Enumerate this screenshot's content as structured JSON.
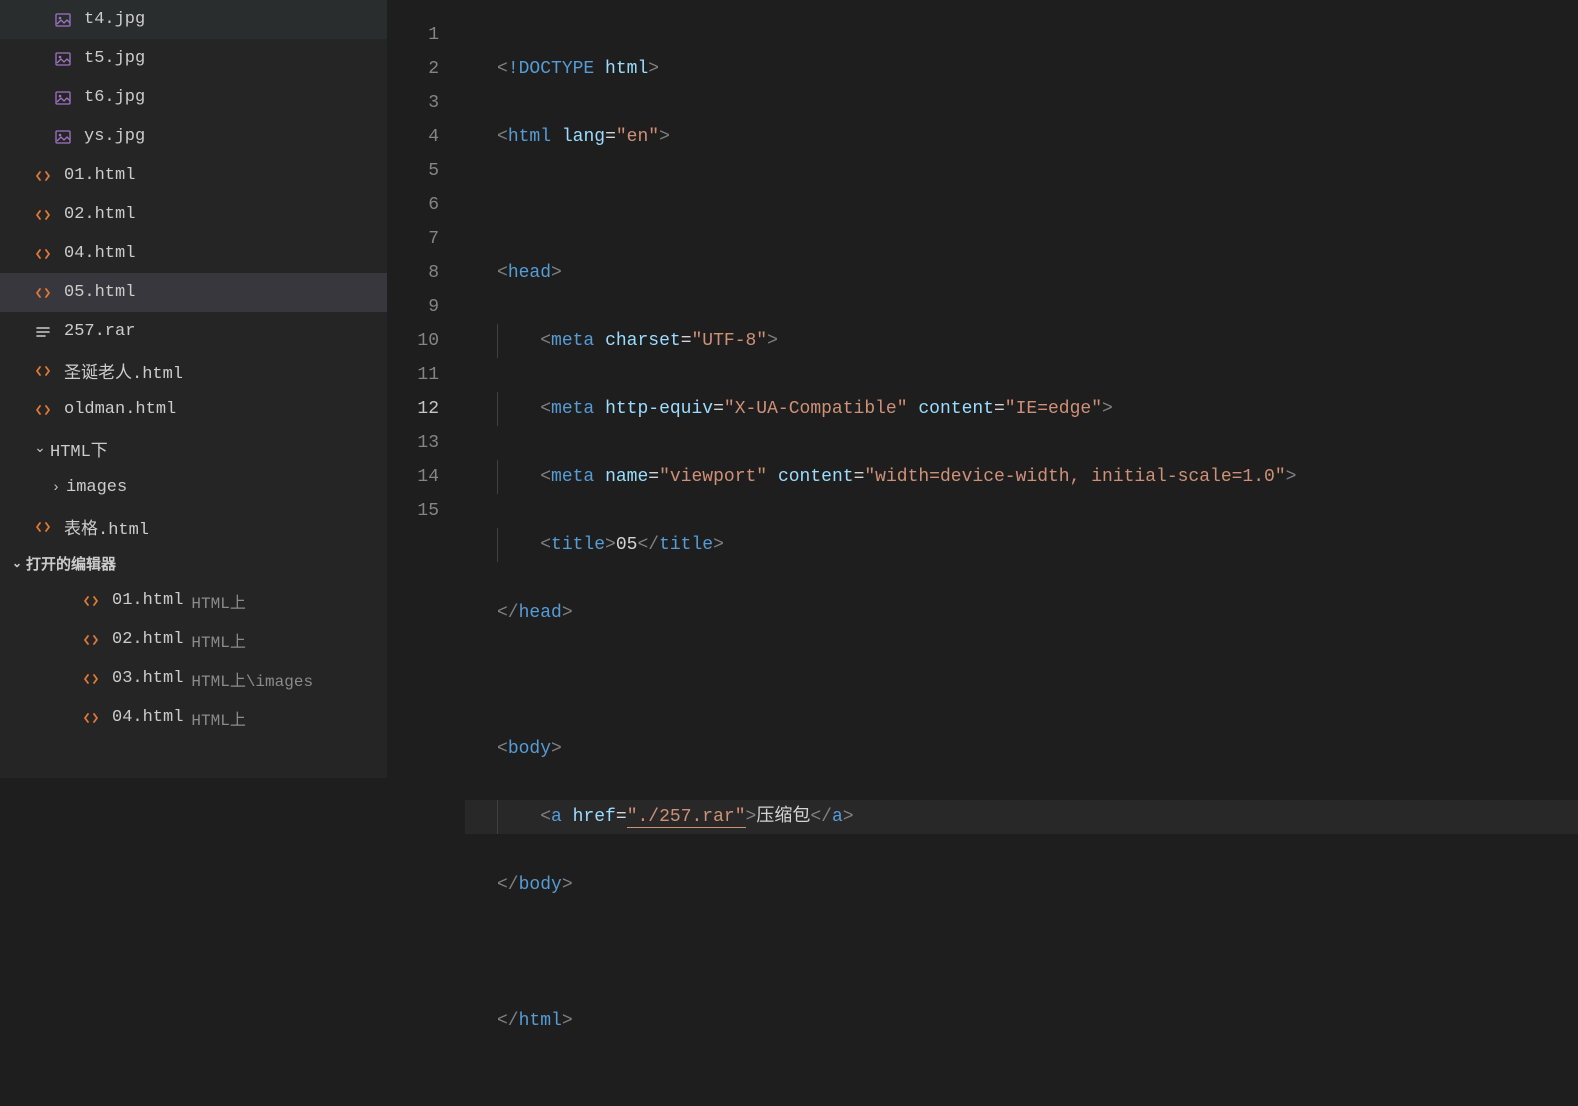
{
  "sidebar": {
    "files": [
      {
        "name": "t4.jpg",
        "type": "img",
        "indent": 2
      },
      {
        "name": "t5.jpg",
        "type": "img",
        "indent": 2
      },
      {
        "name": "t6.jpg",
        "type": "img",
        "indent": 2
      },
      {
        "name": "ys.jpg",
        "type": "img",
        "indent": 2
      },
      {
        "name": "01.html",
        "type": "html",
        "indent": 1
      },
      {
        "name": "02.html",
        "type": "html",
        "indent": 1
      },
      {
        "name": "04.html",
        "type": "html",
        "indent": 1
      },
      {
        "name": "05.html",
        "type": "html",
        "indent": 1,
        "active": true
      },
      {
        "name": "257.rar",
        "type": "file",
        "indent": 1
      },
      {
        "name": "圣诞老人.html",
        "type": "html",
        "indent": 1
      },
      {
        "name": "oldman.html",
        "type": "html",
        "indent": 1
      }
    ],
    "folder_htmlxia": "HTML下",
    "folder_images": "images",
    "file_biaoge": "表格.html",
    "section_open_editors": "打开的编辑器",
    "open_editors": [
      {
        "name": "01.html",
        "path": "HTML上"
      },
      {
        "name": "02.html",
        "path": "HTML上"
      },
      {
        "name": "03.html",
        "path": "HTML上\\images"
      },
      {
        "name": "04.html",
        "path": "HTML上"
      }
    ]
  },
  "code": {
    "line_numbers": [
      "1",
      "2",
      "3",
      "4",
      "5",
      "6",
      "7",
      "8",
      "9",
      "10",
      "11",
      "12",
      "13",
      "14",
      "15"
    ],
    "l1_doctype": "!DOCTYPE",
    "l1_html": "html",
    "l2_tag": "html",
    "l2_attr": "lang",
    "l2_val": "\"en\"",
    "l4_tag": "head",
    "l5_tag": "meta",
    "l5_attr": "charset",
    "l5_val": "\"UTF-8\"",
    "l6_tag": "meta",
    "l6_attr1": "http-equiv",
    "l6_val1": "\"X-UA-Compatible\"",
    "l6_attr2": "content",
    "l6_val2": "\"IE=edge\"",
    "l7_tag": "meta",
    "l7_attr1": "name",
    "l7_val1": "\"viewport\"",
    "l7_attr2": "content",
    "l7_val2": "\"width=device-width, initial-scale=1.0\"",
    "l8_tag": "title",
    "l8_text": "05",
    "l9_tag": "head",
    "l11_tag": "body",
    "l12_tag": "a",
    "l12_attr": "href",
    "l12_val": "\"./257.rar\"",
    "l12_text": "压缩包",
    "l13_tag": "body",
    "l15_tag": "html",
    "lt": "<",
    "gt": ">",
    "lts": "</",
    "eq": "="
  }
}
